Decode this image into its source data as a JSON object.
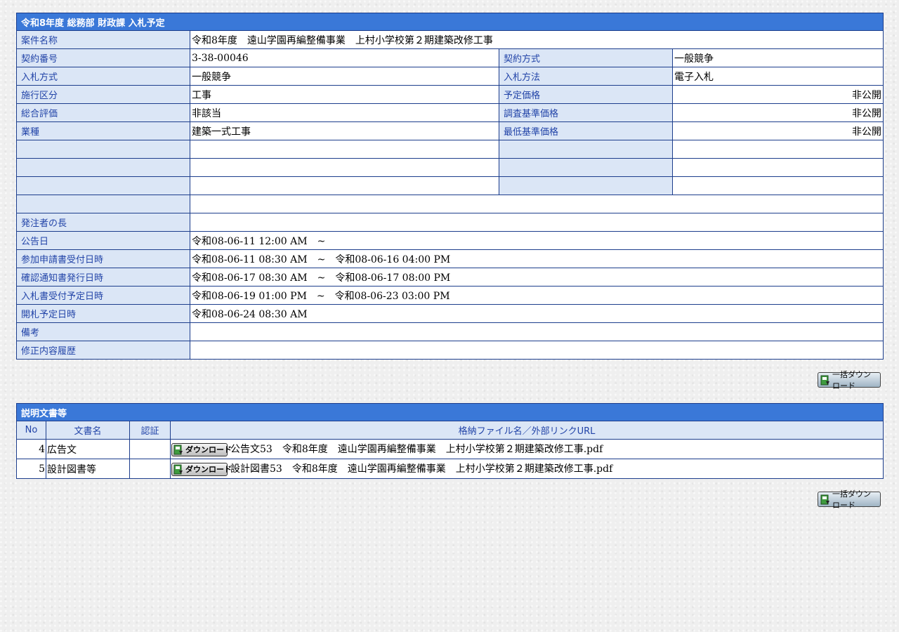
{
  "details": {
    "title": "令和8年度 総務部 財政課 入札予定",
    "project_name_label": "案件名称",
    "project_name": "令和8年度　遠山学園再編整備事業　上村小学校第２期建築改修工事",
    "contract_no_label": "契約番号",
    "contract_no": "3-38-00046",
    "contract_method_label": "契約方式",
    "contract_method": "一般競争",
    "bid_type_label": "入札方式",
    "bid_type": "一般競争",
    "bid_method_label": "入札方法",
    "bid_method": "電子入札",
    "work_type_label": "施行区分",
    "work_type": "工事",
    "planned_price_label": "予定価格",
    "planned_price": "非公開",
    "evaluation_label": "総合評価",
    "evaluation": "非該当",
    "survey_price_label": "調査基準価格",
    "survey_price": "非公開",
    "industry_label": "業種",
    "industry": "建築一式工事",
    "min_price_label": "最低基準価格",
    "min_price": "非公開",
    "orderer_label": "発注者の長",
    "orderer": "",
    "notice_date_label": "公告日",
    "notice_date": "令和08-06-11 12:00 AM　~",
    "application_label": "参加申請書受付日時",
    "application": "令和08-06-11 08:30 AM　~　令和08-06-16 04:00 PM",
    "confirmation_label": "確認通知書発行日時",
    "confirmation": "令和08-06-17 08:30 AM　~　令和08-06-17 08:00 PM",
    "bid_accept_label": "入札書受付予定日時",
    "bid_accept": "令和08-06-19 01:00 PM　~　令和08-06-23 03:00 PM",
    "opening_label": "開札予定日時",
    "opening": "令和08-06-24 08:30 AM",
    "remarks_label": "備考",
    "remarks": "",
    "history_label": "修正内容履歴",
    "history": ""
  },
  "bulk_download_label": "一括ダウンロード",
  "documents": {
    "title": "説明文書等",
    "headers": {
      "no": "No",
      "name": "文書名",
      "cert": "認証",
      "file": "格納ファイル名／外部リンクURL"
    },
    "download_label": "ダウンロード",
    "rows": [
      {
        "no": "4",
        "name": "広告文",
        "cert": "",
        "file": "公告文53　令和8年度　遠山学園再編整備事業　上村小学校第２期建築改修工事.pdf"
      },
      {
        "no": "5",
        "name": "設計図書等",
        "cert": "",
        "file": "設計図書53　令和8年度　遠山学園再編整備事業　上村小学校第２期建築改修工事.pdf"
      }
    ]
  }
}
